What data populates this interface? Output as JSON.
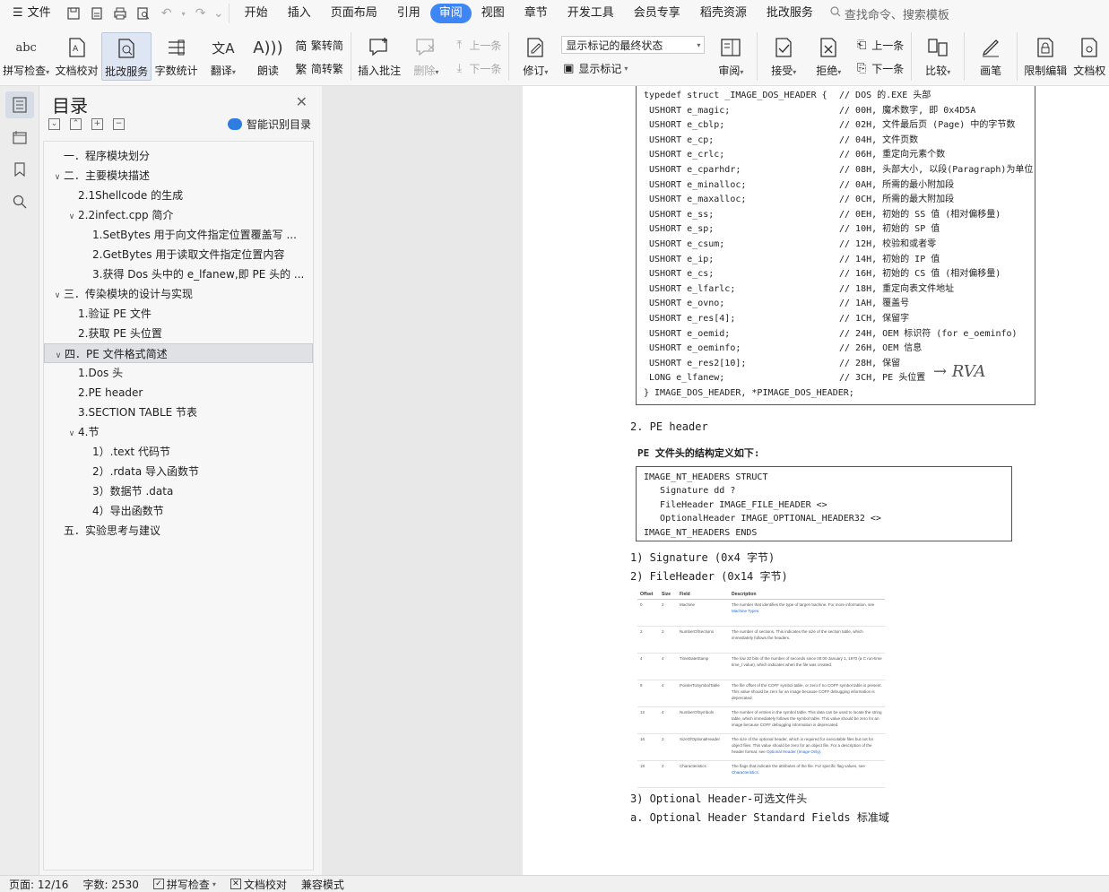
{
  "menubar": {
    "file_label": "文件",
    "tabs": [
      "开始",
      "插入",
      "页面布局",
      "引用",
      "审阅",
      "视图",
      "章节",
      "开发工具",
      "会员专享",
      "稻壳资源",
      "批改服务"
    ],
    "active_tab": "审阅",
    "search_placeholder": "查找命令、搜索模板"
  },
  "ribbon": {
    "spell_check": "拼写检查",
    "doc_proof": "文档校对",
    "correction_service": "批改服务",
    "word_count": "字数统计",
    "translate": "翻译",
    "read_aloud": "朗读",
    "trad_to_simp": "繁转简",
    "simp_to_trad": "简转繁",
    "insert_comment": "插入批注",
    "delete": "删除",
    "prev_comment": "上一条",
    "next_comment": "下一条",
    "track_changes": "修订",
    "markup_select": "显示标记的最终状态",
    "show_markup": "显示标记",
    "review": "审阅",
    "accept": "接受",
    "reject": "拒绝",
    "prev_change": "上一条",
    "next_change": "下一条",
    "compare": "比较",
    "pen": "画笔",
    "restrict_edit": "限制编辑",
    "doc_protect": "文档权"
  },
  "toc": {
    "title": "目录",
    "smart_label": "智能识别目录",
    "items": [
      {
        "text": "一．程序模块划分",
        "level": 0,
        "tw": ""
      },
      {
        "text": "二．主要模块描述",
        "level": 0,
        "tw": "v"
      },
      {
        "text": "2.1Shellcode 的生成",
        "level": 1,
        "tw": ""
      },
      {
        "text": "2.2infect.cpp 简介",
        "level": 1,
        "tw": "v"
      },
      {
        "text": "1.SetBytes 用于向文件指定位置覆盖写 ...",
        "level": 2,
        "tw": ""
      },
      {
        "text": "2.GetBytes 用于读取文件指定位置内容",
        "level": 2,
        "tw": ""
      },
      {
        "text": "3.获得 Dos 头中的 e_lfanew,即 PE 头的 ...",
        "level": 2,
        "tw": ""
      },
      {
        "text": "三．传染模块的设计与实现",
        "level": 0,
        "tw": "v"
      },
      {
        "text": "1.验证 PE 文件",
        "level": 1,
        "tw": ""
      },
      {
        "text": "2.获取 PE 头位置",
        "level": 1,
        "tw": ""
      },
      {
        "text": "四．PE 文件格式简述",
        "level": 0,
        "tw": "v",
        "selected": true
      },
      {
        "text": "1.Dos 头",
        "level": 1,
        "tw": ""
      },
      {
        "text": "2.PE header",
        "level": 1,
        "tw": ""
      },
      {
        "text": "3.SECTION TABLE 节表",
        "level": 1,
        "tw": ""
      },
      {
        "text": "4.节",
        "level": 1,
        "tw": "v"
      },
      {
        "text": "1）.text 代码节",
        "level": 2,
        "tw": ""
      },
      {
        "text": "2）.rdata 导入函数节",
        "level": 2,
        "tw": ""
      },
      {
        "text": "3）数据节 .data",
        "level": 2,
        "tw": ""
      },
      {
        "text": "4）导出函数节",
        "level": 2,
        "tw": ""
      },
      {
        "text": "五．实验思考与建议",
        "level": 0,
        "tw": ""
      }
    ]
  },
  "doc": {
    "code1": [
      {
        "c": "typedef struct _IMAGE_DOS_HEADER {",
        "m": "// DOS 的.EXE 头部"
      },
      {
        "c": " USHORT e_magic;",
        "m": "// 00H, 魔术数字, 即 0x4D5A"
      },
      {
        "c": " USHORT e_cblp;",
        "m": "// 02H, 文件最后页 (Page) 中的字节数"
      },
      {
        "c": " USHORT e_cp;",
        "m": "// 04H, 文件页数"
      },
      {
        "c": " USHORT e_crlc;",
        "m": "// 06H, 重定向元素个数"
      },
      {
        "c": " USHORT e_cparhdr;",
        "m": "// 08H, 头部大小, 以段(Paragraph)为单位"
      },
      {
        "c": " USHORT e_minalloc;",
        "m": "// 0AH, 所需的最小附加段"
      },
      {
        "c": " USHORT e_maxalloc;",
        "m": "// 0CH, 所需的最大附加段"
      },
      {
        "c": " USHORT e_ss;",
        "m": "// 0EH, 初始的 SS 值 (相对偏移量)"
      },
      {
        "c": " USHORT e_sp;",
        "m": "// 10H, 初始的 SP 值"
      },
      {
        "c": " USHORT e_csum;",
        "m": "// 12H, 校验和或者零"
      },
      {
        "c": " USHORT e_ip;",
        "m": "// 14H, 初始的 IP 值"
      },
      {
        "c": " USHORT e_cs;",
        "m": "// 16H, 初始的 CS 值 (相对偏移量)"
      },
      {
        "c": " USHORT e_lfarlc;",
        "m": "// 18H, 重定向表文件地址"
      },
      {
        "c": " USHORT e_ovno;",
        "m": "// 1AH, 覆盖号"
      },
      {
        "c": " USHORT e_res[4];",
        "m": "// 1CH, 保留字"
      },
      {
        "c": " USHORT e_oemid;",
        "m": "// 24H, OEM 标识符 (for e_oeminfo)"
      },
      {
        "c": " USHORT e_oeminfo;",
        "m": "// 26H, OEM 信息"
      },
      {
        "c": " USHORT e_res2[10];",
        "m": "// 28H, 保留"
      },
      {
        "c": " LONG e_lfanew;",
        "m": "// 3CH, PE 头位置"
      },
      {
        "c": "} IMAGE_DOS_HEADER, *PIMAGE_DOS_HEADER;",
        "m": ""
      }
    ],
    "handwritten_note": "→ RVA",
    "pe_header_heading": "2. PE header",
    "pe_struct_intro": "PE 文件头的结构定义如下:",
    "code2": [
      "IMAGE_NT_HEADERS STRUCT",
      "   Signature dd ?",
      "   FileHeader IMAGE_FILE_HEADER <>",
      "   OptionalHeader IMAGE_OPTIONAL_HEADER32 <>",
      "IMAGE_NT_HEADERS ENDS"
    ],
    "signature_line": "1) Signature (0x4 字节)",
    "fileheader_line": "2) FileHeader (0x14 字节)",
    "table": {
      "headers": [
        "Offset",
        "Size",
        "Field",
        "Description"
      ],
      "rows": [
        {
          "o": "0",
          "s": "2",
          "f": "Machine",
          "d": "The number that identifies the type of target machine. For more information, see",
          "link": "Machine Types."
        },
        {
          "o": "2",
          "s": "2",
          "f": "NumberOfSections",
          "d": "The number of sections. This indicates the size of the section table, which immediately follows the headers.",
          "link": ""
        },
        {
          "o": "4",
          "s": "4",
          "f": "TimeDateStamp",
          "d": "The low 32 bits of the number of seconds since 00:00 January 1, 1970 (a C run-time time_t value), which indicates when the file was created.",
          "link": ""
        },
        {
          "o": "8",
          "s": "4",
          "f": "PointerToSymbolTable",
          "d": "The file offset of the COFF symbol table, or zero if no COFF symbol table is present. This value should be zero for an image because COFF debugging information is deprecated.",
          "link": ""
        },
        {
          "o": "12",
          "s": "4",
          "f": "NumberOfSymbols",
          "d": "The number of entries in the symbol table. This data can be used to locate the string table, which immediately follows the symbol table. This value should be zero for an image because COFF debugging information is deprecated.",
          "link": ""
        },
        {
          "o": "16",
          "s": "2",
          "f": "SizeOfOptionalHeader",
          "d": "The size of the optional header, which is required for executable files but not for object files. This value should be zero for an object file. For a description of the header format, see",
          "link": "Optional Header (Image Only)."
        },
        {
          "o": "18",
          "s": "2",
          "f": "Characteristics",
          "d": "The flags that indicate the attributes of the file. For specific flag values, see",
          "link": "Characteristics."
        }
      ]
    },
    "optional_header_line": "3) Optional Header-可选文件头",
    "std_fields_line": "a. Optional Header Standard Fields 标准域"
  },
  "status": {
    "page": "页面: 12/16",
    "words": "字数: 2530",
    "spell": "拼写检查",
    "proof": "文档校对",
    "compat": "兼容模式"
  }
}
